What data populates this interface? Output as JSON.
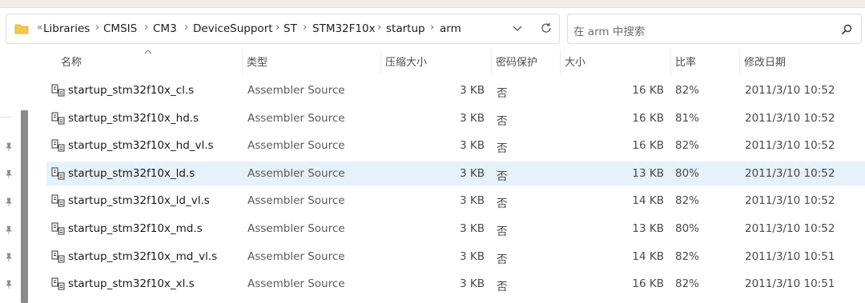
{
  "address": {
    "more": "«",
    "crumbs": [
      "Libraries",
      "CMSIS",
      "CM3",
      "DeviceSupport",
      "ST",
      "STM32F10x",
      "startup",
      "arm"
    ]
  },
  "search": {
    "placeholder": "在 arm 中搜索"
  },
  "columns": {
    "name": "名称",
    "type": "类型",
    "compressed_size": "压缩大小",
    "password": "密码保护",
    "size": "大小",
    "ratio": "比率",
    "modified": "修改日期"
  },
  "files": [
    {
      "name": "startup_stm32f10x_cl.s",
      "type": "Assembler Source",
      "compressed_size": "3 KB",
      "password": "否",
      "size": "16 KB",
      "ratio": "82%",
      "modified": "2011/3/10 10:52"
    },
    {
      "name": "startup_stm32f10x_hd.s",
      "type": "Assembler Source",
      "compressed_size": "3 KB",
      "password": "否",
      "size": "16 KB",
      "ratio": "81%",
      "modified": "2011/3/10 10:52"
    },
    {
      "name": "startup_stm32f10x_hd_vl.s",
      "type": "Assembler Source",
      "compressed_size": "3 KB",
      "password": "否",
      "size": "16 KB",
      "ratio": "82%",
      "modified": "2011/3/10 10:52"
    },
    {
      "name": "startup_stm32f10x_ld.s",
      "type": "Assembler Source",
      "compressed_size": "3 KB",
      "password": "否",
      "size": "13 KB",
      "ratio": "80%",
      "modified": "2011/3/10 10:52",
      "selected": true
    },
    {
      "name": "startup_stm32f10x_ld_vl.s",
      "type": "Assembler Source",
      "compressed_size": "3 KB",
      "password": "否",
      "size": "14 KB",
      "ratio": "82%",
      "modified": "2011/3/10 10:52"
    },
    {
      "name": "startup_stm32f10x_md.s",
      "type": "Assembler Source",
      "compressed_size": "3 KB",
      "password": "否",
      "size": "13 KB",
      "ratio": "80%",
      "modified": "2011/3/10 10:52"
    },
    {
      "name": "startup_stm32f10x_md_vl.s",
      "type": "Assembler Source",
      "compressed_size": "3 KB",
      "password": "否",
      "size": "14 KB",
      "ratio": "82%",
      "modified": "2011/3/10 10:51"
    },
    {
      "name": "startup_stm32f10x_xl.s",
      "type": "Assembler Source",
      "compressed_size": "3 KB",
      "password": "否",
      "size": "16 KB",
      "ratio": "82%",
      "modified": "2011/3/10 10:51"
    }
  ],
  "icons": {
    "folder": "folder-icon",
    "dropdown": "chevron-down-icon",
    "refresh": "refresh-icon",
    "search": "search-icon",
    "sort": "sort-ascending-icon",
    "pin": "pin-icon",
    "file": "assembler-file-icon"
  },
  "colors": {
    "selected_row": "#e5f1fb",
    "folder": "#f2c94c",
    "scrollbar": "#8a8a8a"
  }
}
